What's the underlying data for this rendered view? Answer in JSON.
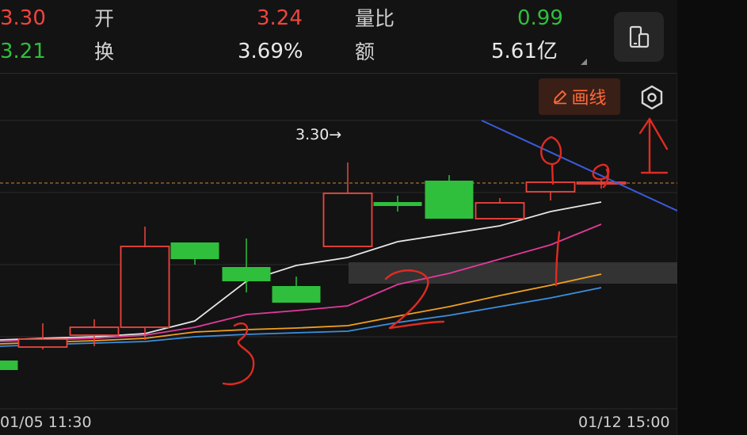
{
  "stats": {
    "row1": {
      "partial_value": "3.30",
      "label_a": "开",
      "value_a": "3.24",
      "label_b": "量比",
      "value_b": "0.99"
    },
    "row2": {
      "partial_value": "3.21",
      "label_a": "换",
      "value_a": "3.69%",
      "label_b": "额",
      "value_b": "5.61亿"
    }
  },
  "toolbar": {
    "draw_label": "画线",
    "draw_icon": "pencil-icon",
    "settings_icon": "hexagon-settings-icon",
    "device_icon": "phone-tablet-icon"
  },
  "chart": {
    "high_annotation": "3.30→",
    "time_start": "01/05 11:30",
    "time_end": "01/12 15:00"
  },
  "colors": {
    "up": "#f0443d",
    "down": "#2fbf3c",
    "draw_accent": "#ff6a3a",
    "ma_white": "#e6e6e6",
    "ma_pink": "#e23a9c",
    "ma_orange": "#f0a020",
    "ma_blue": "#3a8fe0",
    "trendline": "#3b5bdc"
  },
  "chart_data": {
    "type": "candlestick",
    "candles": [
      {
        "open": 3.05,
        "close": 3.038,
        "high": 3.05,
        "low": 3.035
      },
      {
        "open": 3.067,
        "close": 3.077,
        "high": 3.097,
        "low": 3.064
      },
      {
        "open": 3.082,
        "close": 3.092,
        "high": 3.102,
        "low": 3.068
      },
      {
        "open": 3.092,
        "close": 3.194,
        "high": 3.219,
        "low": 3.076
      },
      {
        "open": 3.199,
        "close": 3.178,
        "high": 3.199,
        "low": 3.171
      },
      {
        "open": 3.168,
        "close": 3.15,
        "high": 3.204,
        "low": 3.136
      },
      {
        "open": 3.144,
        "close": 3.123,
        "high": 3.156,
        "low": 3.123
      },
      {
        "open": 3.194,
        "close": 3.261,
        "high": 3.3,
        "low": 3.194
      },
      {
        "open": 3.25,
        "close": 3.245,
        "high": 3.258,
        "low": 3.238
      },
      {
        "open": 3.277,
        "close": 3.229,
        "high": 3.284,
        "low": 3.229
      },
      {
        "open": 3.229,
        "close": 3.249,
        "high": 3.255,
        "low": 3.229
      },
      {
        "open": 3.263,
        "close": 3.275,
        "high": 3.276,
        "low": 3.252
      },
      {
        "open": 3.273,
        "close": 3.275,
        "high": 3.28,
        "low": 3.267
      }
    ],
    "ma_white": [
      3.078,
      3.08,
      3.084,
      3.1,
      3.15,
      3.17,
      3.18,
      3.2,
      3.21,
      3.22,
      3.238,
      3.25
    ],
    "ma_pink": [
      3.076,
      3.078,
      3.082,
      3.092,
      3.108,
      3.113,
      3.119,
      3.146,
      3.16,
      3.178,
      3.196,
      3.222
    ],
    "ma_orange": [
      3.073,
      3.075,
      3.078,
      3.086,
      3.089,
      3.091,
      3.094,
      3.106,
      3.118,
      3.132,
      3.145,
      3.159
    ],
    "ma_blue": [
      3.07,
      3.072,
      3.074,
      3.08,
      3.083,
      3.085,
      3.087,
      3.098,
      3.107,
      3.118,
      3.129,
      3.142
    ]
  }
}
